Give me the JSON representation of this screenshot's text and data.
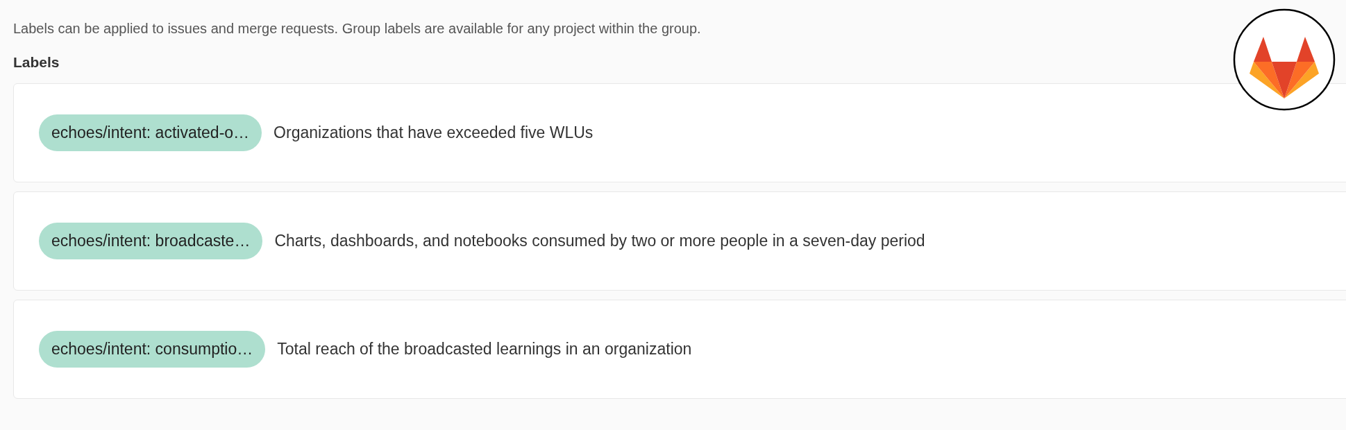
{
  "intro": "Labels can be applied to issues and merge requests. Group labels are available for any project within the group.",
  "heading": "Labels",
  "labels": [
    {
      "name": "echoes/intent: activated-o…",
      "description": "Organizations that have exceeded five WLUs"
    },
    {
      "name": "echoes/intent: broadcaste…",
      "description": "Charts, dashboards, and notebooks consumed by two or more people in a seven-day period"
    },
    {
      "name": "echoes/intent: consumptio…",
      "description": "Total reach of the broadcasted learnings in an organization"
    }
  ]
}
